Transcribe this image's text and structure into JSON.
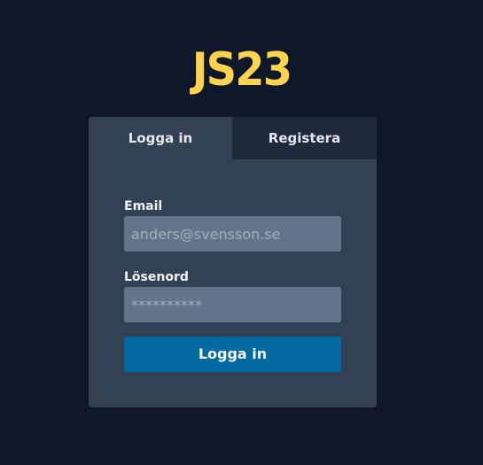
{
  "app": {
    "logo_text": "JS23"
  },
  "colors": {
    "background": "#0f172a",
    "logo": "#fcd34d",
    "card": "#334155",
    "inactive_tab": "#1e293b",
    "input": "#64748b",
    "button": "#0369a1"
  },
  "tabs": [
    {
      "label": "Logga in",
      "active": true
    },
    {
      "label": "Registera",
      "active": false
    }
  ],
  "form": {
    "email": {
      "label": "Email",
      "placeholder": "anders@svensson.se",
      "value": ""
    },
    "password": {
      "label": "Lösenord",
      "placeholder": "**********",
      "value": ""
    },
    "submit_label": "Logga in"
  }
}
